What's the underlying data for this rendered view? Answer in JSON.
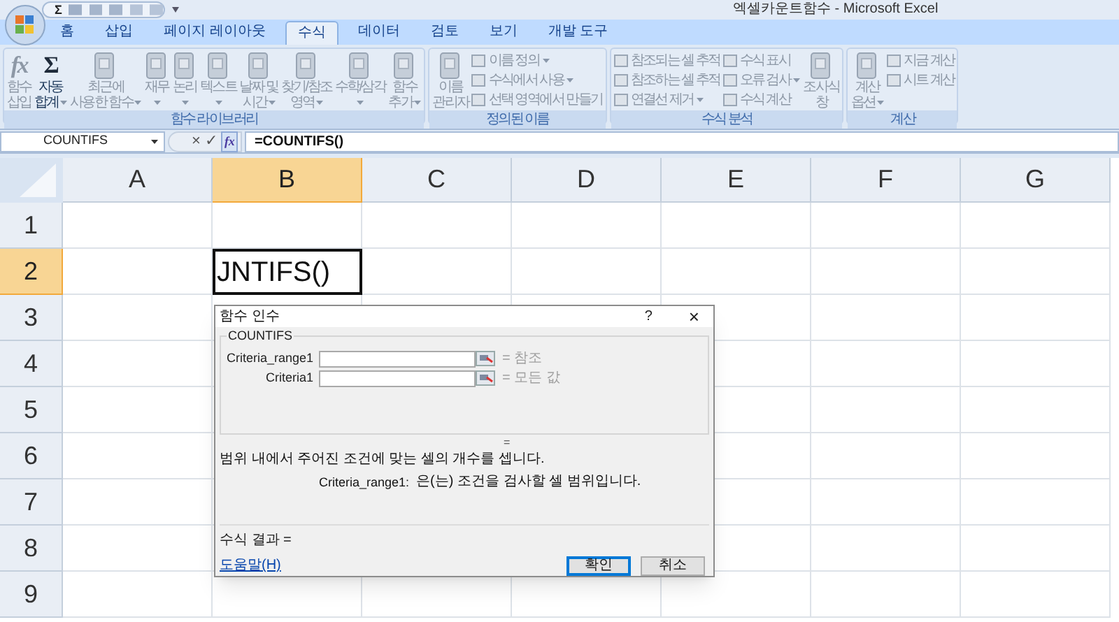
{
  "window": {
    "title": "엑셀카운트함수 - Microsoft Excel"
  },
  "quick_access": {
    "glyph": "Σ"
  },
  "tabs": [
    {
      "label": "홈",
      "selected": false
    },
    {
      "label": "삽입",
      "selected": false
    },
    {
      "label": "페이지 레이아웃",
      "selected": false
    },
    {
      "label": "수식",
      "selected": true
    },
    {
      "label": "데이터",
      "selected": false
    },
    {
      "label": "검토",
      "selected": false
    },
    {
      "label": "보기",
      "selected": false
    },
    {
      "label": "개발 도구",
      "selected": false
    }
  ],
  "ribbon_groups": [
    {
      "title": "함수 라이브러리",
      "items": [
        {
          "kind": "large",
          "lines": [
            "함수",
            "삽입"
          ],
          "glyph": "fx",
          "dropdown": false,
          "disabled": true
        },
        {
          "kind": "large",
          "lines": [
            "자동",
            "합계"
          ],
          "glyph": "Σ",
          "dropdown": true,
          "disabled": false
        },
        {
          "kind": "large",
          "lines": [
            "최근에",
            "사용한 함수"
          ],
          "dropdown": true,
          "disabled": true
        },
        {
          "kind": "large",
          "lines": [
            "재무"
          ],
          "dropdown": true,
          "disabled": true
        },
        {
          "kind": "large",
          "lines": [
            "논리"
          ],
          "dropdown": true,
          "disabled": true
        },
        {
          "kind": "large",
          "lines": [
            "텍스트"
          ],
          "dropdown": true,
          "disabled": true
        },
        {
          "kind": "large",
          "lines": [
            "날짜 및",
            "시간"
          ],
          "dropdown": true,
          "disabled": true
        },
        {
          "kind": "large",
          "lines": [
            "찾기/참조",
            "영역"
          ],
          "dropdown": true,
          "disabled": true
        },
        {
          "kind": "large",
          "lines": [
            "수학/삼각"
          ],
          "dropdown": true,
          "disabled": true
        },
        {
          "kind": "large",
          "lines": [
            "함수",
            "추가"
          ],
          "dropdown": true,
          "disabled": true
        }
      ]
    },
    {
      "title": "정의된 이름",
      "items": [
        {
          "kind": "large",
          "lines": [
            "이름",
            "관리자"
          ],
          "dropdown": false,
          "disabled": true
        },
        {
          "kind": "small",
          "label": "이름 정의",
          "dropdown": true,
          "disabled": true
        },
        {
          "kind": "small",
          "label": "수식에서 사용",
          "dropdown": true,
          "disabled": true
        },
        {
          "kind": "small",
          "label": "선택 영역에서 만들기",
          "dropdown": false,
          "disabled": true
        }
      ]
    },
    {
      "title": "수식 분석",
      "items": [
        {
          "kind": "small",
          "label": "참조되는 셀 추적",
          "dropdown": false,
          "disabled": true
        },
        {
          "kind": "small",
          "label": "참조하는 셀 추적",
          "dropdown": false,
          "disabled": true
        },
        {
          "kind": "small",
          "label": "연결선 제거",
          "dropdown": true,
          "disabled": true
        },
        {
          "kind": "small",
          "label": "수식 표시",
          "dropdown": false,
          "disabled": true
        },
        {
          "kind": "small",
          "label": "오류 검사",
          "dropdown": true,
          "disabled": true
        },
        {
          "kind": "small",
          "label": "수식 계산",
          "dropdown": false,
          "disabled": true
        },
        {
          "kind": "large",
          "lines": [
            "조사식",
            "창"
          ],
          "dropdown": false,
          "disabled": true
        }
      ]
    },
    {
      "title": "계산",
      "items": [
        {
          "kind": "large",
          "lines": [
            "계산",
            "옵션"
          ],
          "dropdown": true,
          "disabled": true
        },
        {
          "kind": "small",
          "label": "지금 계산",
          "dropdown": false,
          "disabled": true
        },
        {
          "kind": "small",
          "label": "시트 계산",
          "dropdown": false,
          "disabled": true
        }
      ]
    }
  ],
  "formula_bar": {
    "name_box": "COUNTIFS",
    "cancel": "×",
    "enter": "✓",
    "insert_function": "fx",
    "formula": "=COUNTIFS()"
  },
  "sheet": {
    "columns": [
      {
        "label": "A",
        "selected": false
      },
      {
        "label": "B",
        "selected": true
      },
      {
        "label": "C",
        "selected": false
      },
      {
        "label": "D",
        "selected": false
      },
      {
        "label": "E",
        "selected": false
      },
      {
        "label": "F",
        "selected": false
      },
      {
        "label": "G",
        "selected": false
      }
    ],
    "rows": [
      {
        "label": "1",
        "selected": false
      },
      {
        "label": "2",
        "selected": true
      },
      {
        "label": "3",
        "selected": false
      },
      {
        "label": "4",
        "selected": false
      },
      {
        "label": "5",
        "selected": false
      },
      {
        "label": "6",
        "selected": false
      },
      {
        "label": "7",
        "selected": false
      },
      {
        "label": "8",
        "selected": false
      },
      {
        "label": "9",
        "selected": false
      }
    ],
    "active_cell": {
      "value": "JNTIFS()"
    }
  },
  "dialog": {
    "title": "함수 인수",
    "help_glyph": "?",
    "close_glyph": "×",
    "function": "COUNTIFS",
    "arguments": [
      {
        "label": "Criteria_range1",
        "result": "= 참조"
      },
      {
        "label": "Criteria1",
        "result": "= 모든 값"
      }
    ],
    "function_result": "=",
    "description": "범위 내에서 주어진 조건에 맞는 셀의 개수를 셉니다.",
    "argument_name": "Criteria_range1:",
    "argument_help": "은(는) 조건을 검사할 셀 범위입니다.",
    "formula_result": "수식 결과 =",
    "help_link": "도움말(H)",
    "ok": "확인",
    "cancel": "취소"
  }
}
